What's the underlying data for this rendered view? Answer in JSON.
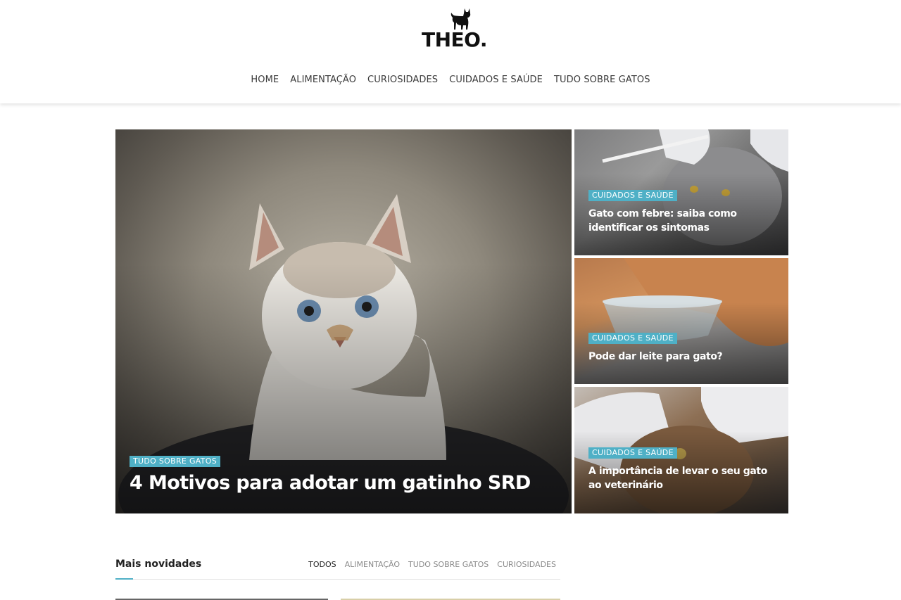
{
  "site": {
    "logo_text": "THEO.",
    "logo_icon": "cat-silhouette-icon"
  },
  "nav": {
    "items": [
      "HOME",
      "ALIMENTAÇÃO",
      "CURIOSIDADES",
      "CUIDADOS E SAÚDE",
      "TUDO SOBRE GATOS"
    ]
  },
  "featured": {
    "main": {
      "category": "TUDO SOBRE GATOS",
      "title": "4 Motivos para adotar um gatinho SRD"
    },
    "side": [
      {
        "category": "CUIDADOS E SAÚDE",
        "title": "Gato com febre: saiba como identificar os sintomas"
      },
      {
        "category": "CUIDADOS E SAÚDE",
        "title": "Pode dar leite para gato?"
      },
      {
        "category": "CUIDADOS E SAÚDE",
        "title": "A importância de levar o seu gato ao veterinário"
      }
    ]
  },
  "latest": {
    "title": "Mais novidades",
    "tabs": [
      "TODOS",
      "ALIMENTAÇÃO",
      "TUDO SOBRE GATOS",
      "CURIOSIDADES"
    ],
    "active_tab": "TODOS"
  },
  "colors": {
    "accent": "#4fb0c6",
    "nav_text": "#3a3a3a"
  }
}
